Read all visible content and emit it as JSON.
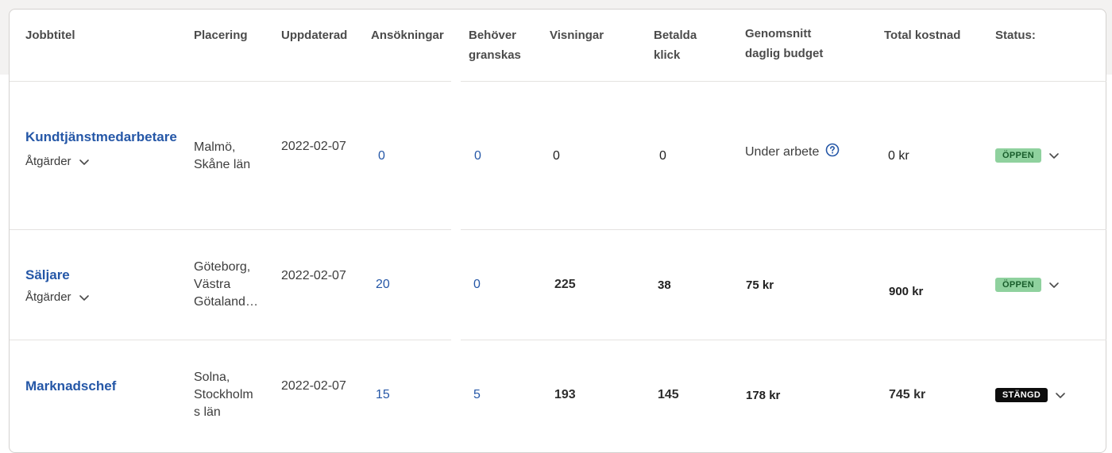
{
  "table": {
    "headers": {
      "job_title": "Jobbtitel",
      "location": "Placering",
      "updated": "Uppdaterad",
      "applications": "Ansökningar",
      "needs_review_line1": "Behöver",
      "needs_review_line2": "granskas",
      "views": "Visningar",
      "paid_clicks_line1": "Betalda",
      "paid_clicks_line2": "klick",
      "avg_budget_line1": "Genomsnitt",
      "avg_budget_line2": "daglig budget",
      "total_cost": "Total kostnad",
      "status": "Status:"
    },
    "rows": [
      {
        "title": "Kundtjänstmedarbetare",
        "actions": "Åtgärder",
        "location_lines": [
          "Malmö,",
          "Skåne län"
        ],
        "updated": "2022-02-07",
        "applications": "0",
        "needs_review": "0",
        "views": "0",
        "paid_clicks": "0",
        "avg_budget": "Under arbete",
        "total_cost": "0 kr",
        "status": "ÖPPEN"
      },
      {
        "title": "Säljare",
        "actions": "Åtgärder",
        "location_lines": [
          "Göteborg,",
          "Västra",
          "Götaland…"
        ],
        "updated": "2022-02-07",
        "applications": "20",
        "needs_review": "0",
        "views": "225",
        "paid_clicks": "38",
        "avg_budget": "75 kr",
        "total_cost": "900 kr",
        "status": "ÖPPEN"
      },
      {
        "title": "Marknadschef",
        "location_lines": [
          "Solna,",
          "Stockholm",
          "s län"
        ],
        "updated": "2022-02-07",
        "applications": "15",
        "needs_review": "5",
        "views": "193",
        "paid_clicks": "145",
        "avg_budget": "178 kr",
        "total_cost": "745 kr",
        "status": "STÄNGD"
      }
    ]
  },
  "colors": {
    "link": "#2557a7",
    "badge_open_bg": "#8fd19e",
    "badge_closed_bg": "#0d0d0d"
  },
  "icons": {
    "help": "help-circle-icon",
    "chevron": "chevron-down-icon"
  }
}
